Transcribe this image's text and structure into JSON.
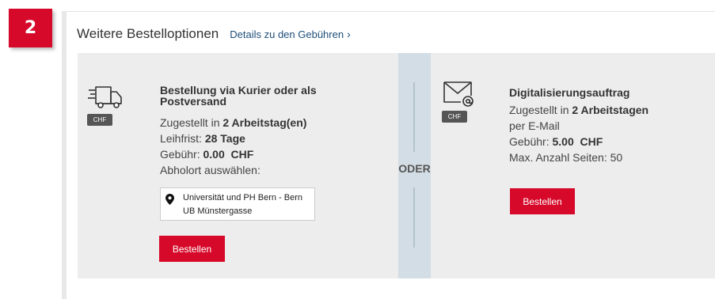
{
  "step_number": "2",
  "header": {
    "title": "Weitere Bestelloptionen",
    "fees_link": "Details zu den Gebühren",
    "chevron": "›"
  },
  "courier": {
    "icon": "delivery-truck-icon",
    "currency_badge": "CHF",
    "title": "Bestellung via Kurier oder als Postversand",
    "delivered_prefix": "Zugestellt in ",
    "delivered_value": "2 Arbeitstag(en)",
    "loan_prefix": "Leihfrist: ",
    "loan_value": "28 Tage",
    "fee_prefix": "Gebühr: ",
    "fee_value": "0.00  CHF",
    "pickup_label": "Abholort auswählen:",
    "location_line1": "Universität und PH Bern - Bern",
    "location_line2": "UB Münstergasse",
    "order_label": "Bestellen"
  },
  "divider": {
    "label": "ODER"
  },
  "digital": {
    "icon": "email-envelope-icon",
    "currency_badge": "CHF",
    "title": "Digitalisierungsauftrag",
    "delivered_prefix": "Zugestellt in ",
    "delivered_value": "2 Arbeitstagen",
    "delivery_method": "per E-Mail",
    "fee_prefix": "Gebühr: ",
    "fee_value": "5.00  CHF",
    "max_pages": "Max. Anzahl Seiten: 50",
    "order_label": "Bestellen"
  },
  "colors": {
    "accent_red": "#d7092a",
    "link_blue": "#1f4e79",
    "panel_gray": "#ededed",
    "divider_blue": "#d3dde5"
  }
}
